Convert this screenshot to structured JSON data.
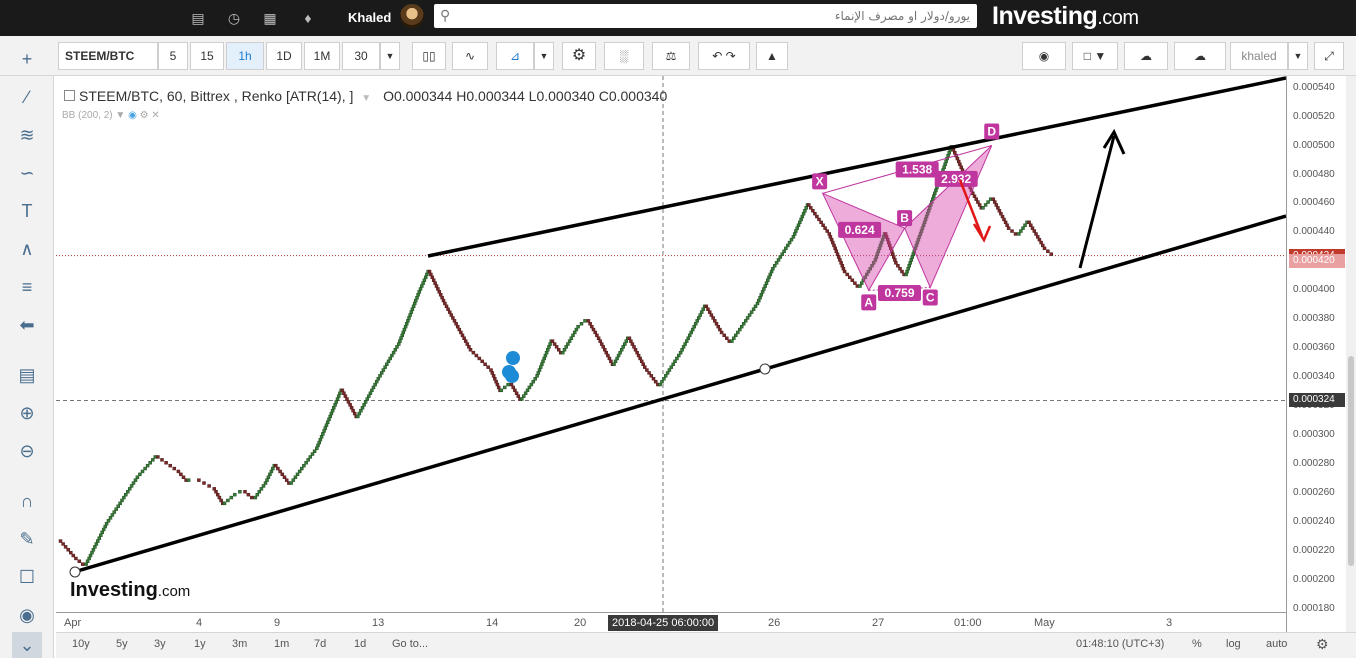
{
  "topbar": {
    "user_name": "Khaled",
    "search_placeholder": "يورو/دولار او مصرف الإنماء",
    "logo_main": "Investing",
    "logo_suffix": ".com",
    "icons": [
      "chart-icon",
      "clock-icon",
      "briefcase-icon",
      "bell-icon"
    ]
  },
  "toolbar": {
    "symbol": "STEEM/BTC",
    "intervals": [
      "5",
      "15",
      "1h",
      "1D",
      "1M",
      "30"
    ],
    "active_interval": "1h",
    "profile": "khaled"
  },
  "legend": {
    "title": "STEEM/BTC, 60, Bittrex , Renko [ATR(14), ]",
    "open": "O0.000344",
    "high": "H0.000344",
    "low": "L0.000340",
    "close": "C0.000340",
    "indicator": "BB (200, 2)"
  },
  "chart_data": {
    "type": "line",
    "symbol": "STEEM/BTC",
    "y_ticks": [
      "0.000540",
      "0.000520",
      "0.000500",
      "0.000480",
      "0.000460",
      "0.000440",
      "0.000420",
      "0.000400",
      "0.000380",
      "0.000360",
      "0.000340",
      "0.000320",
      "0.000300",
      "0.000280",
      "0.000260",
      "0.000240",
      "0.000220",
      "0.000200",
      "0.000180"
    ],
    "ylim": [
      0.000178,
      0.000548
    ],
    "x_ticks": [
      "Apr",
      "4",
      "9",
      "13",
      "14",
      "20",
      "26",
      "27",
      "01:00",
      "May",
      "3"
    ],
    "crosshair_time": "2018-04-25 06:00:00",
    "price_last": "0.000424",
    "price_marker_2": "0.000420",
    "crosshair_price": "0.000324",
    "renko_path": [
      [
        0,
        0.000228
      ],
      [
        3,
        0.000216
      ],
      [
        5,
        0.00021
      ],
      [
        9,
        0.000238
      ],
      [
        15,
        0.00027
      ],
      [
        19,
        0.000286
      ],
      [
        23,
        0.000276
      ],
      [
        25,
        0.000268
      ],
      [
        27,
        0.00027
      ],
      [
        29,
        0.000266
      ],
      [
        30,
        0.000264
      ],
      [
        32,
        0.000252
      ],
      [
        34,
        0.000258
      ],
      [
        36,
        0.000262
      ],
      [
        38,
        0.000256
      ],
      [
        40,
        0.000266
      ],
      [
        42,
        0.00028
      ],
      [
        45,
        0.000266
      ],
      [
        50,
        0.00029
      ],
      [
        55,
        0.000332
      ],
      [
        58,
        0.000312
      ],
      [
        62,
        0.000338
      ],
      [
        66,
        0.000362
      ],
      [
        70,
        0.000398
      ],
      [
        72,
        0.000414
      ],
      [
        75,
        0.000392
      ],
      [
        80,
        0.00036
      ],
      [
        84,
        0.000346
      ],
      [
        86,
        0.00033
      ],
      [
        88,
        0.000336
      ],
      [
        90,
        0.000324
      ],
      [
        93,
        0.00034
      ],
      [
        96,
        0.000366
      ],
      [
        98,
        0.000356
      ],
      [
        101,
        0.000374
      ],
      [
        103,
        0.00038
      ],
      [
        105,
        0.000368
      ],
      [
        108,
        0.000348
      ],
      [
        111,
        0.000368
      ],
      [
        114,
        0.000348
      ],
      [
        117,
        0.000334
      ],
      [
        121,
        0.000356
      ],
      [
        126,
        0.00039
      ],
      [
        129,
        0.000372
      ],
      [
        131,
        0.000364
      ],
      [
        136,
        0.00039
      ],
      [
        139,
        0.000414
      ],
      [
        143,
        0.000436
      ],
      [
        146,
        0.00046
      ],
      [
        150,
        0.00044
      ],
      [
        153,
        0.000414
      ],
      [
        156,
        0.000402
      ],
      [
        159,
        0.00042
      ],
      [
        161,
        0.00044
      ],
      [
        163,
        0.00042
      ],
      [
        165,
        0.00041
      ],
      [
        168,
        0.00044
      ],
      [
        171,
        0.00047
      ],
      [
        174,
        0.0005
      ],
      [
        178,
        0.000468
      ],
      [
        180,
        0.000456
      ],
      [
        182,
        0.000464
      ],
      [
        185,
        0.000444
      ],
      [
        187,
        0.000438
      ],
      [
        189,
        0.000448
      ],
      [
        192,
        0.00043
      ],
      [
        194,
        0.000424
      ]
    ],
    "pattern": {
      "X": [
        149,
        0.000467
      ],
      "A": [
        158,
        0.0004
      ],
      "B": [
        165,
        0.000443
      ],
      "C": [
        170,
        0.000402
      ],
      "D": [
        182,
        0.0005
      ],
      "ratios": [
        "0.624",
        "1.538",
        "0.759",
        "2.932"
      ]
    }
  },
  "pattern_labels": [
    "X",
    "A",
    "B",
    "C",
    "D"
  ],
  "bottom": {
    "ranges": [
      "10y",
      "5y",
      "3y",
      "1y",
      "3m",
      "1m",
      "7d",
      "1d"
    ],
    "goto": "Go to...",
    "time": "01:48:10 (UTC+3)",
    "percent": "%",
    "log": "log",
    "auto": "auto"
  },
  "watermark": {
    "main": "Investing",
    "suffix": ".com"
  }
}
